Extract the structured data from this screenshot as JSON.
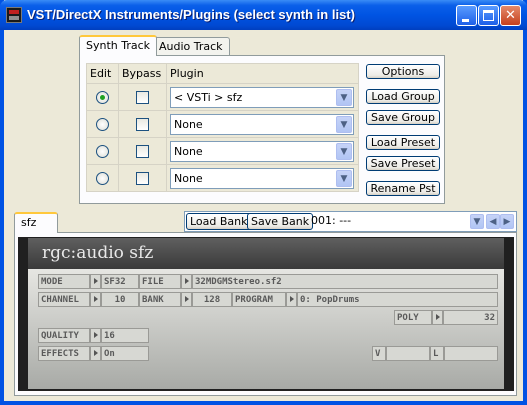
{
  "window": {
    "title": "VST/DirectX Instruments/Plugins (select synth in list)"
  },
  "tabs": [
    {
      "label": "Synth Track",
      "active": true
    },
    {
      "label": "Audio Track",
      "active": false
    }
  ],
  "plugin_table": {
    "headers": [
      "Edit",
      "Bypass",
      "Plugin"
    ],
    "rows": [
      {
        "edit_selected": true,
        "bypass": false,
        "plugin": "< VSTi > sfz"
      },
      {
        "edit_selected": false,
        "bypass": false,
        "plugin": "None"
      },
      {
        "edit_selected": false,
        "bypass": false,
        "plugin": "None"
      },
      {
        "edit_selected": false,
        "bypass": false,
        "plugin": "None"
      }
    ]
  },
  "side_buttons": [
    "Options",
    "Load Group",
    "Save Group",
    "Load Preset",
    "Save Preset",
    "Rename Pst"
  ],
  "synth_tab": {
    "label": "sfz"
  },
  "bank": {
    "load_label": "Load Bank",
    "save_label": "Save Bank",
    "value": "001: ---"
  },
  "sfz": {
    "brand": "rgc:audio sfz",
    "mode_label": "MODE",
    "mode_value": "SF32",
    "file_label": "FILE",
    "file_value": "32MDGMStereo.sf2",
    "channel_label": "CHANNEL",
    "channel_value": "10",
    "bank_label": "BANK",
    "bank_value": "128",
    "program_label": "PROGRAM",
    "program_value": "0: PopDrums",
    "poly_label": "POLY",
    "poly_value": "32",
    "quality_label": "QUALITY",
    "quality_value": "16",
    "effects_label": "EFFECTS",
    "effects_value": "On",
    "v_label": "V",
    "l_label": "L"
  }
}
